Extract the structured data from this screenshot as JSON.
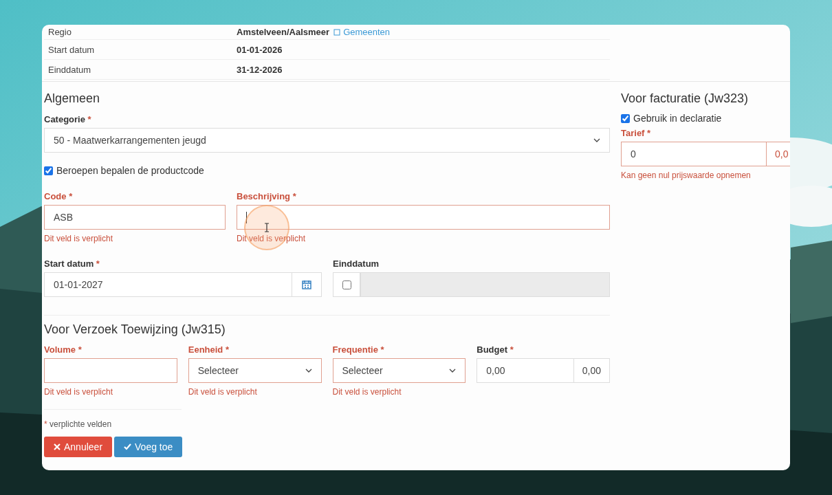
{
  "info_rows": [
    {
      "label": "Regio",
      "value": "Amstelveen/Aalsmeer",
      "link": "Gemeenten"
    },
    {
      "label": "Start datum",
      "value": "01-01-2026"
    },
    {
      "label": "Einddatum",
      "value": "31-12-2026"
    }
  ],
  "general": {
    "title": "Algemeen",
    "category": {
      "label": "Categorie",
      "mark": "*",
      "value": "50 - Maatwerkarrangementen jeugd"
    },
    "productcode": {
      "label": "Beroepen bepalen de productcode",
      "checked": true
    },
    "code": {
      "label": "Code",
      "mark": "*",
      "value": "ASB",
      "error": "Dit veld is verplicht"
    },
    "description": {
      "label": "Beschrijving",
      "mark": "*",
      "error": "Dit veld is verplicht"
    },
    "start": {
      "label": "Start datum",
      "mark": "*",
      "value": "01-01-2027"
    },
    "end": {
      "label": "Einddatum",
      "checked": false
    }
  },
  "request": {
    "title": "Voor Verzoek Toewijzing (Jw315)",
    "fields": [
      {
        "kind": "input",
        "label": "Volume",
        "mark": "*",
        "invalid": true,
        "error": "Dit veld is verplicht"
      },
      {
        "kind": "select",
        "label": "Eenheid",
        "mark": "*",
        "invalid": true,
        "value": "Selecteer",
        "error": "Dit veld is verplicht"
      },
      {
        "kind": "select",
        "label": "Frequentie",
        "mark": "*",
        "invalid": true,
        "value": "Selecteer",
        "error": "Dit veld is verplicht"
      },
      {
        "kind": "money",
        "label": "Budget",
        "mark": "*",
        "invalid": false,
        "value": "0,00",
        "addon": "0,00"
      }
    ]
  },
  "required_note": {
    "mark": "*",
    "text": "verplichte velden"
  },
  "buttons": [
    {
      "kind": "danger",
      "label": "Annuleer"
    },
    {
      "kind": "primary",
      "label": "Voeg toe"
    }
  ],
  "billing": {
    "title": "Voor facturatie (Jw323)",
    "use": {
      "label": "Gebruik in declaratie",
      "checked": true
    },
    "tariff": {
      "label": "Tarief",
      "mark": "*",
      "value": "0",
      "addon": "0,0",
      "error": "Kan geen nul prijswaarde opnemen"
    }
  }
}
